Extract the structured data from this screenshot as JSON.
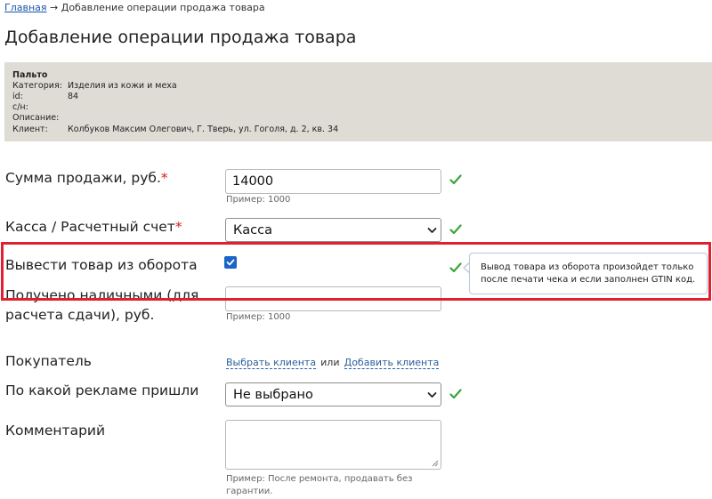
{
  "breadcrumb": {
    "home": "Главная",
    "separator": "→",
    "current": "Добавление операции продажа товара"
  },
  "page": {
    "title": "Добавление операции продажа товара"
  },
  "product": {
    "name": "Пальто",
    "rows": [
      {
        "key": "Категория:",
        "value": "Изделия из кожи и меха"
      },
      {
        "key": "id:",
        "value": "84"
      },
      {
        "key": "с/н:",
        "value": ""
      },
      {
        "key": "Описание:",
        "value": ""
      },
      {
        "key": "Клиент:",
        "value": "Колбуков Максим Олегович, Г. Тверь, ул. Гоголя, д. 2, кв. 34"
      }
    ]
  },
  "form": {
    "required_mark": "*",
    "sale_amount": {
      "label": "Сумма продажи, руб.",
      "value": "14000",
      "hint": "Пример: 1000"
    },
    "cashbox": {
      "label": "Касса / Расчетный счет",
      "value": "Касса"
    },
    "withdraw": {
      "label": "Вывести товар из оборота",
      "checked": true,
      "tooltip": "Вывод товара из оборота произойдет только после печати чека и если заполнен GTIN код."
    },
    "cash_received": {
      "label_line1": "Получено наличными (для",
      "label_line2": "расчета сдачи), руб.",
      "value": "",
      "hint": "Пример: 1000"
    },
    "buyer": {
      "label": "Покупатель",
      "select_link": "Выбрать клиента",
      "or": "или",
      "add_link": "Добавить клиента"
    },
    "ad_source": {
      "label": "По какой рекламе пришли",
      "value": "Не выбрано"
    },
    "comment": {
      "label": "Комментарий",
      "hint_line1": "Пример: После ремонта, продавать без",
      "hint_line2": "гарантии."
    }
  },
  "colors": {
    "accent": "#1a66c8",
    "valid": "#3aa53a",
    "required": "#d0221e",
    "highlight": "#e02030",
    "info_bg": "#dedcd5"
  }
}
